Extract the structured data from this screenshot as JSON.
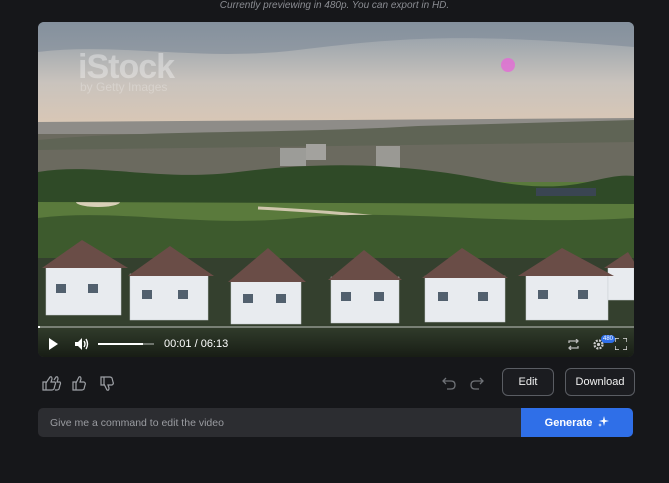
{
  "notice": "Currently previewing in 480p. You can export in HD.",
  "player": {
    "watermark": "iStock",
    "watermark_sub": "by Getty Images",
    "progress": 0.003,
    "volume": 0.8,
    "time_display": "00:01 / 06:13",
    "quality_badge": "480",
    "icons": [
      "play-icon",
      "volume-icon",
      "loop-icon",
      "settings-icon",
      "fullscreen-icon"
    ]
  },
  "actions": {
    "icons": [
      "thumbs-up-double-icon",
      "thumbs-up-icon",
      "thumbs-down-icon",
      "undo-icon",
      "redo-icon"
    ],
    "edit_label": "Edit",
    "download_label": "Download"
  },
  "command": {
    "placeholder": "Give me a command to edit the video",
    "value": "",
    "generate_label": "Generate"
  },
  "colors": {
    "background": "#16171a",
    "accent": "#2f6fe8",
    "input_bg": "#2c2d31"
  }
}
